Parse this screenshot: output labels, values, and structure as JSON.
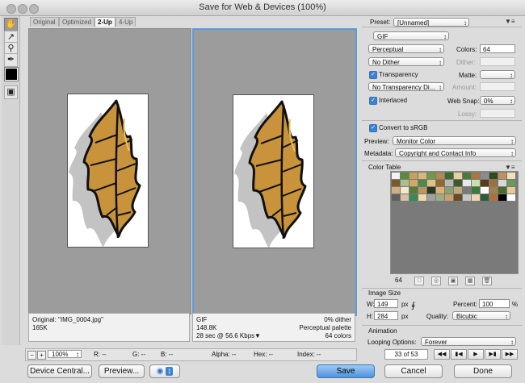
{
  "window": {
    "title": "Save for Web & Devices (100%)"
  },
  "tabs": [
    {
      "label": "Original"
    },
    {
      "label": "Optimized"
    },
    {
      "label": "2-Up"
    },
    {
      "label": "4-Up"
    }
  ],
  "original_info": {
    "name": "Original: \"IMG_0004.jpg\"",
    "size": "165K"
  },
  "optimized_info": {
    "format": "GIF",
    "size": "148.8K",
    "speed": "28 sec @ 56.6 Kbps",
    "dither": "0% dither",
    "palette": "Perceptual palette",
    "colors": "64 colors"
  },
  "status": {
    "zoom": "100%",
    "r": "R: --",
    "g": "G: --",
    "b": "B: --",
    "alpha": "Alpha: --",
    "hex": "Hex: --",
    "index": "Index: --"
  },
  "buttons": {
    "device_central": "Device Central...",
    "preview": "Preview...",
    "save": "Save",
    "cancel": "Cancel",
    "done": "Done"
  },
  "settings": {
    "preset_label": "Preset:",
    "preset_value": "[Unnamed]",
    "format": "GIF",
    "reduction": "Perceptual",
    "colors_label": "Colors:",
    "colors_value": "64",
    "dither_algo": "No Dither",
    "dither_label": "Dither:",
    "transparency_label": "Transparency",
    "matte_label": "Matte:",
    "transparency_dither": "No Transparency Di...",
    "amount_label": "Amount:",
    "interlaced_label": "Interlaced",
    "websnap_label": "Web Snap:",
    "websnap_value": "0%",
    "lossy_label": "Lossy:",
    "convert_label": "Convert to sRGB",
    "preview_label": "Preview:",
    "preview_value": "Monitor Color",
    "metadata_label": "Metadata:",
    "metadata_value": "Copyright and Contact Info"
  },
  "color_table": {
    "title": "Color Table",
    "count": "64",
    "swatches": [
      "#f2f2f2",
      "#5a8a3a",
      "#c8a060",
      "#d8b878",
      "#6e9a4a",
      "#b08850",
      "#3e6a2a",
      "#e8d0a0",
      "#4a7a3a",
      "#a87840",
      "#8c8c8c",
      "#2e4a1e",
      "#c09060",
      "#f0e0c0",
      "#7a5a2a",
      "#a8c090",
      "#d0a868",
      "#4c8a4c",
      "#e0c088",
      "#906830",
      "#b8b8b8",
      "#3a5a2a",
      "#e8e8e8",
      "#c8e0b0",
      "#5c3a1a",
      "#9a7040",
      "#d8d8d8",
      "#6a9a5a",
      "#d0b080",
      "#f4e8d0",
      "#5a7a3a",
      "#b89860",
      "#2a3a1a",
      "#e0b070",
      "#8aa070",
      "#c0a878",
      "#7a7a7a",
      "#3a7a3a",
      "#ffffff",
      "#a08050",
      "#4a6a2a",
      "#e8c898",
      "#606060",
      "#d8c0a0",
      "#3a8a5a",
      "#f0d8a8",
      "#a0a0a0",
      "#9ab080",
      "#caa070",
      "#6a4a20",
      "#c8c8c8",
      "#ecd8b0",
      "#2c5a3a",
      "#b07038",
      "#000000",
      "#ffffff"
    ]
  },
  "image_size": {
    "title": "Image Size",
    "w_label": "W:",
    "w_value": "149",
    "h_label": "H:",
    "h_value": "284",
    "unit": "px",
    "percent_label": "Percent:",
    "percent_value": "100",
    "percent_unit": "%",
    "quality_label": "Quality:",
    "quality_value": "Bicubic"
  },
  "animation": {
    "title": "Animation",
    "looping_label": "Looping Options:",
    "looping_value": "Forever",
    "frame": "33 of 53"
  },
  "colors": {
    "accent": "#5f9ad8",
    "leaf_fill": "#c9933c",
    "leaf_outline": "#111111"
  }
}
